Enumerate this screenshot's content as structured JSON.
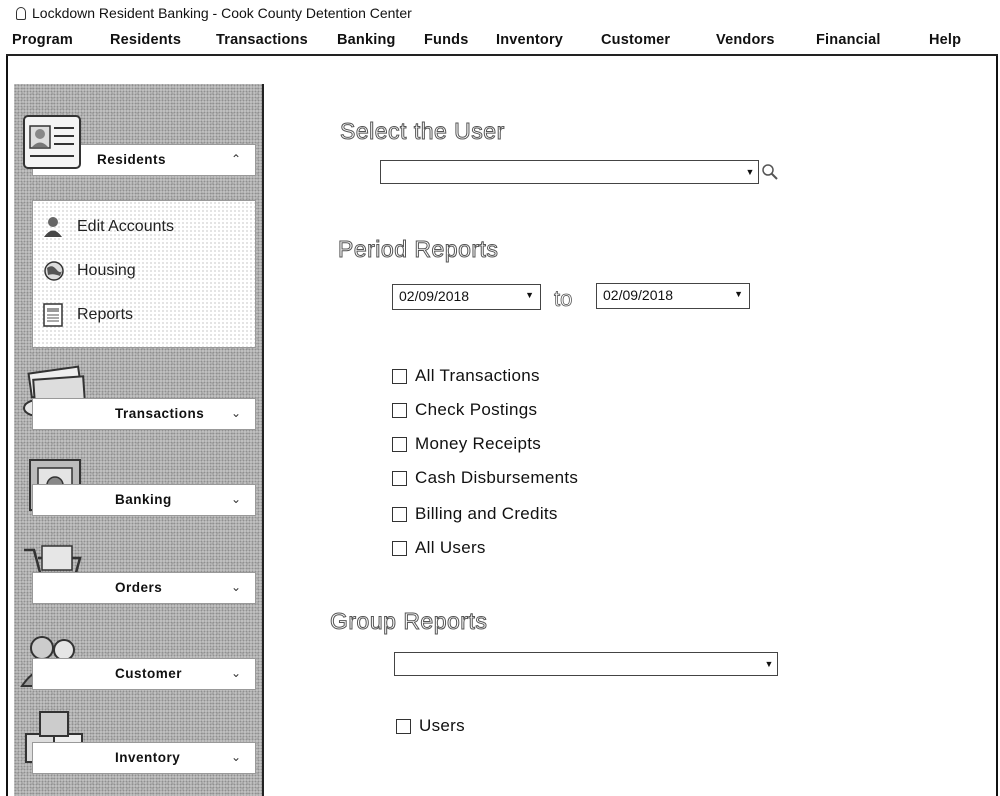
{
  "window": {
    "title": "Lockdown Resident Banking - Cook County Detention Center"
  },
  "menu": [
    {
      "label": "Program"
    },
    {
      "label": "Residents"
    },
    {
      "label": "Transactions"
    },
    {
      "label": "Banking"
    },
    {
      "label": "Funds"
    },
    {
      "label": "Inventory"
    },
    {
      "label": "Customer"
    },
    {
      "label": "Vendors"
    },
    {
      "label": "Financial"
    },
    {
      "label": "Help"
    }
  ],
  "sidebar": {
    "residents": {
      "label": "Residents",
      "items": [
        {
          "label": "Edit Accounts",
          "icon": "user-icon"
        },
        {
          "label": "Housing",
          "icon": "globe-icon"
        },
        {
          "label": "Reports",
          "icon": "report-icon"
        }
      ]
    },
    "panels": [
      {
        "label": "Transactions",
        "icon": "cash-icon"
      },
      {
        "label": "Banking",
        "icon": "safe-icon"
      },
      {
        "label": "Orders",
        "icon": "cart-icon"
      },
      {
        "label": "Customer",
        "icon": "people-icon"
      },
      {
        "label": "Inventory",
        "icon": "boxes-icon"
      }
    ]
  },
  "main": {
    "select_user": {
      "heading": "Select the User",
      "value": ""
    },
    "period": {
      "heading": "Period Reports",
      "from": "02/09/2018",
      "separator": "to",
      "to": "02/09/2018",
      "options": [
        {
          "label": "All Transactions",
          "checked": false
        },
        {
          "label": "Check Postings",
          "checked": false
        },
        {
          "label": "Money Receipts",
          "checked": false
        },
        {
          "label": "Cash Disbursements",
          "checked": false
        },
        {
          "label": "Billing and Credits",
          "checked": false
        },
        {
          "label": "All Users",
          "checked": false
        }
      ]
    },
    "group": {
      "heading": "Group Reports",
      "value": "",
      "options": [
        {
          "label": "Users",
          "checked": false
        }
      ]
    }
  }
}
